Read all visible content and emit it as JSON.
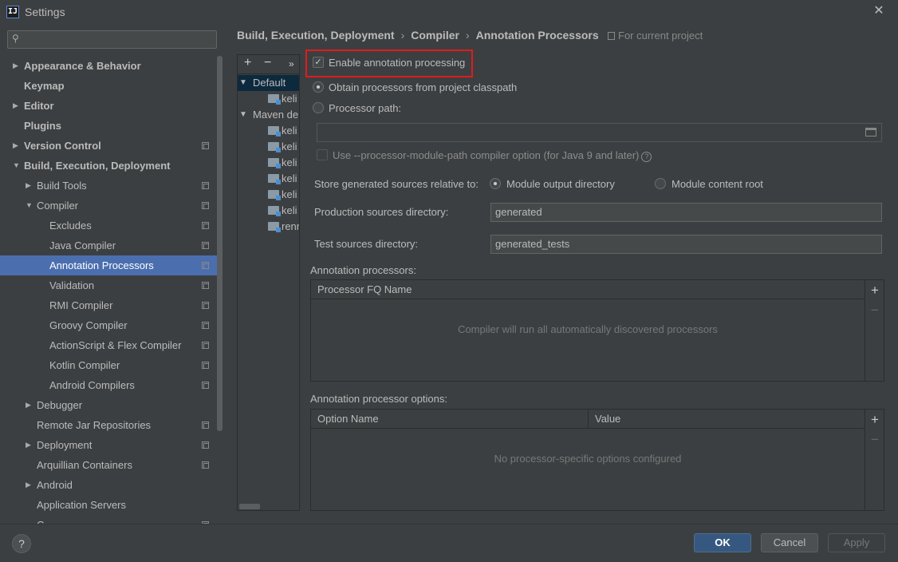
{
  "window": {
    "title": "Settings",
    "close_glyph": "✕"
  },
  "sidebar": {
    "search": {
      "value": "",
      "placeholder": ""
    },
    "items": [
      {
        "label": "Appearance & Behavior",
        "arrow": "▶"
      },
      {
        "label": "Keymap"
      },
      {
        "label": "Editor",
        "arrow": "▶"
      },
      {
        "label": "Plugins"
      },
      {
        "label": "Version Control",
        "arrow": "▶"
      },
      {
        "label": "Build, Execution, Deployment",
        "arrow": "▼"
      },
      {
        "label": "Build Tools",
        "arrow": "▶"
      },
      {
        "label": "Compiler",
        "arrow": "▼"
      },
      {
        "label": "Excludes"
      },
      {
        "label": "Java Compiler"
      },
      {
        "label": "Annotation Processors"
      },
      {
        "label": "Validation"
      },
      {
        "label": "RMI Compiler"
      },
      {
        "label": "Groovy Compiler"
      },
      {
        "label": "ActionScript & Flex Compiler"
      },
      {
        "label": "Kotlin Compiler"
      },
      {
        "label": "Android Compilers"
      },
      {
        "label": "Debugger",
        "arrow": "▶"
      },
      {
        "label": "Remote Jar Repositories"
      },
      {
        "label": "Deployment",
        "arrow": "▶"
      },
      {
        "label": "Arquillian Containers"
      },
      {
        "label": "Android",
        "arrow": "▶"
      },
      {
        "label": "Application Servers"
      },
      {
        "label": "C..."
      }
    ]
  },
  "breadcrumb": {
    "parts": [
      "Build, Execution, Deployment",
      "Compiler",
      "Annotation Processors"
    ],
    "sep": "›",
    "scope": "For current project"
  },
  "profiles": {
    "toolbar": {
      "add": "+",
      "remove": "−",
      "more": "»"
    },
    "default_label": "Default",
    "maven_label": "Maven de",
    "arrow_down": "▼",
    "modules": [
      "keli",
      "keli",
      "keli",
      "keli",
      "keli",
      "keli",
      "keli",
      "renr"
    ]
  },
  "options": {
    "enable_label": "Enable annotation processing",
    "enable_check": "✓",
    "obtain_label": "Obtain processors from project classpath",
    "path_label": "Processor path:",
    "path_value": "",
    "module_path_label": "Use --processor-module-path compiler option (for Java 9 and later)",
    "help_glyph": "?",
    "store_label": "Store generated sources relative to:",
    "module_output_label": "Module output directory",
    "module_content_label": "Module content root",
    "prod_label": "Production sources directory:",
    "prod_value": "generated",
    "test_label": "Test sources directory:",
    "test_value": "generated_tests"
  },
  "processors_table": {
    "title": "Annotation processors:",
    "column": "Processor FQ Name",
    "empty": "Compiler will run all automatically discovered processors",
    "add": "+",
    "remove": "−"
  },
  "options_table": {
    "title": "Annotation processor options:",
    "columns": [
      "Option Name",
      "Value"
    ],
    "empty": "No processor-specific options configured",
    "add": "+",
    "remove": "−"
  },
  "buttons": {
    "help": "?",
    "ok": "OK",
    "cancel": "Cancel",
    "apply": "Apply"
  },
  "colors": {
    "background": "#3c3f41",
    "selection": "#4b6eaf",
    "highlight_border": "#e01b1b",
    "ok_button": "#365880"
  }
}
